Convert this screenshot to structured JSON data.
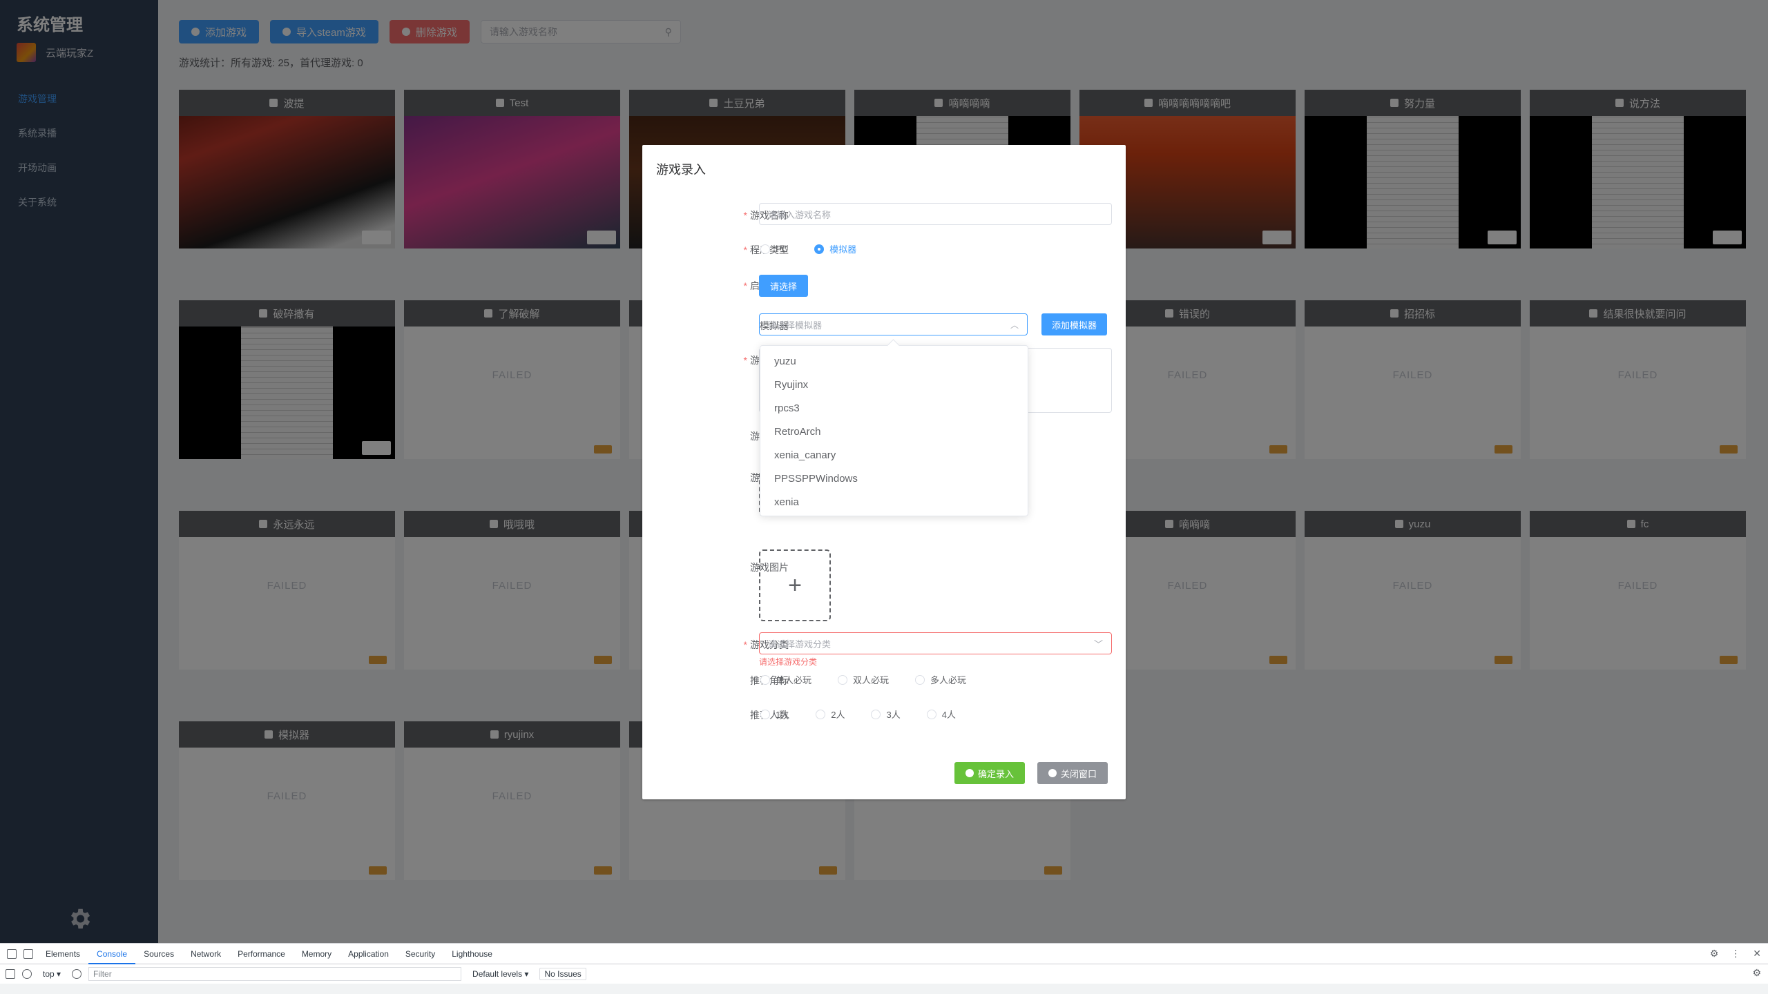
{
  "sidebar": {
    "title": "系统管理",
    "user_name": "云端玩家Z",
    "menu": [
      {
        "label": "游戏管理",
        "active": true
      },
      {
        "label": "系统录播"
      },
      {
        "label": "开场动画"
      },
      {
        "label": "关于系统"
      }
    ]
  },
  "toolbar": {
    "add_game": "添加游戏",
    "import_steam": "导入steam游戏",
    "delete_game": "删除游戏",
    "search_placeholder": "请输入游戏名称"
  },
  "stats": "游戏统计：所有游戏: 25，首代理游戏: 0",
  "cards": [
    {
      "title": "波提",
      "image": "metroid",
      "tag": "white"
    },
    {
      "title": "Test",
      "image": "bot",
      "tag": "white"
    },
    {
      "title": "土豆兄弟",
      "image": "dark",
      "tag": "white"
    },
    {
      "title": "嘀嘀嘀嘀",
      "image": "sheet",
      "tag": "white"
    },
    {
      "title": "嘀嘀嘀嘀嘀嘀吧",
      "image": "red",
      "tag": "white"
    },
    {
      "title": "努力量",
      "image": "sheet",
      "tag": "white"
    },
    {
      "title": "说方法",
      "image": "sheet",
      "tag": "white"
    },
    {
      "title": "破碎撒有",
      "image": "sheet",
      "tag": "white"
    },
    {
      "title": "了解破解",
      "failed": "FAILED"
    },
    {
      "title": "",
      "failed": "FAILED"
    },
    {
      "title": "",
      "failed": "FAILED"
    },
    {
      "title": "错误的",
      "failed": "FAILED"
    },
    {
      "title": "招招标",
      "failed": "FAILED"
    },
    {
      "title": "结果很快就要问问",
      "failed": "FAILED"
    },
    {
      "title": "永远永远",
      "failed": "FAILED"
    },
    {
      "title": "哦哦哦",
      "failed": "FAILED"
    },
    {
      "title": "",
      "failed": "FAILED"
    },
    {
      "title": "",
      "failed": "FAILED"
    },
    {
      "title": "嘀嘀嘀",
      "failed": "FAILED"
    },
    {
      "title": "yuzu",
      "failed": "FAILED"
    },
    {
      "title": "fc",
      "failed": "FAILED"
    },
    {
      "title": "模拟器",
      "failed": "FAILED"
    },
    {
      "title": "ryujinx",
      "failed": "FAILED"
    },
    {
      "title": "",
      "failed": "FAILED"
    },
    {
      "title": "",
      "failed": "FAILED"
    }
  ],
  "dialog": {
    "title": "游戏录入",
    "game_name_label": "游戏名称",
    "game_name_placeholder": "请输入游戏名称",
    "program_type_label": "程序类型",
    "type_pc": "PC",
    "type_emulator": "模拟器",
    "launcher_label": "启动程序",
    "choose_button": "请选择",
    "emulator_label": "模拟器",
    "emulator_placeholder": "请选择模拟器",
    "add_emulator_button": "添加模拟器",
    "intro_label": "游戏简介",
    "video_label": "游戏视频",
    "cover_label": "游戏封面",
    "images_label": "游戏图片",
    "category_label": "游戏分类",
    "category_placeholder": "请选择游戏分类",
    "category_error": "请选择游戏分类",
    "badge_label": "推荐角标",
    "badges": [
      "单人必玩",
      "双人必玩",
      "多人必玩"
    ],
    "players_label": "推荐人数",
    "players": [
      "1人",
      "2人",
      "3人",
      "4人"
    ],
    "confirm_button": "确定录入",
    "close_button": "关闭窗口"
  },
  "emulator_options": [
    "yuzu",
    "Ryujinx",
    "rpcs3",
    "RetroArch",
    "xenia_canary",
    "PPSSPPWindows",
    "xenia"
  ],
  "devtools": {
    "tabs": [
      "Elements",
      "Console",
      "Sources",
      "Network",
      "Performance",
      "Memory",
      "Application",
      "Security",
      "Lighthouse"
    ],
    "active_tab": "Console",
    "context": "top",
    "filter_placeholder": "Filter",
    "levels": "Default levels",
    "issues": "No Issues"
  },
  "colors": {
    "primary": "#409eff",
    "danger": "#f56c6c",
    "success": "#67c23a",
    "sidebar": "#304156"
  }
}
